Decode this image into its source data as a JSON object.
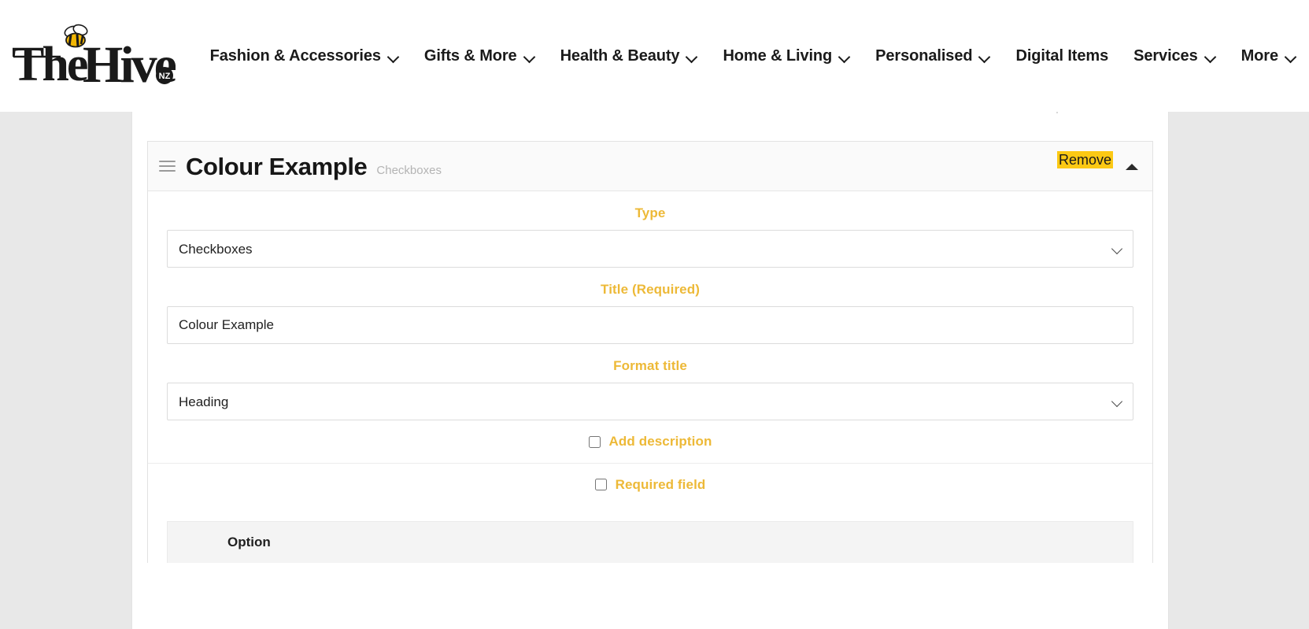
{
  "site": {
    "logo": {
      "text_line": "The Hive",
      "badge": "NZ",
      "bee_icon": "bee-icon"
    },
    "nav": [
      {
        "label": "Fashion & Accessories",
        "has_dropdown": true
      },
      {
        "label": "Gifts & More",
        "has_dropdown": true
      },
      {
        "label": "Health & Beauty",
        "has_dropdown": true
      },
      {
        "label": "Home & Living",
        "has_dropdown": true
      },
      {
        "label": "Personalised",
        "has_dropdown": true
      },
      {
        "label": "Digital Items",
        "has_dropdown": false
      },
      {
        "label": "Services",
        "has_dropdown": true
      },
      {
        "label": "More",
        "has_dropdown": true
      }
    ]
  },
  "field_card": {
    "title": "Colour Example",
    "subtitle": "Checkboxes",
    "drag_handle_icon": "hamburger-drag-icon",
    "remove_label": "Remove",
    "collapse_icon": "caret-up-icon",
    "fields": {
      "type": {
        "label": "Type",
        "value": "Checkboxes",
        "options": [
          "Checkboxes"
        ]
      },
      "title": {
        "label": "Title (Required)",
        "value": "Colour Example",
        "placeholder": ""
      },
      "format_title": {
        "label": "Format title",
        "value": "Heading",
        "options": [
          "Heading"
        ]
      },
      "add_description": {
        "label": "Add description",
        "checked": false
      },
      "required_field": {
        "label": "Required field",
        "checked": false
      }
    },
    "options_table": {
      "columns": [
        "Option"
      ]
    }
  },
  "colors": {
    "accent_gold": "#edb937",
    "highlight_yellow": "#fcc914",
    "text_dark": "#1a1a1a",
    "muted_gray": "#b4b4b4"
  }
}
